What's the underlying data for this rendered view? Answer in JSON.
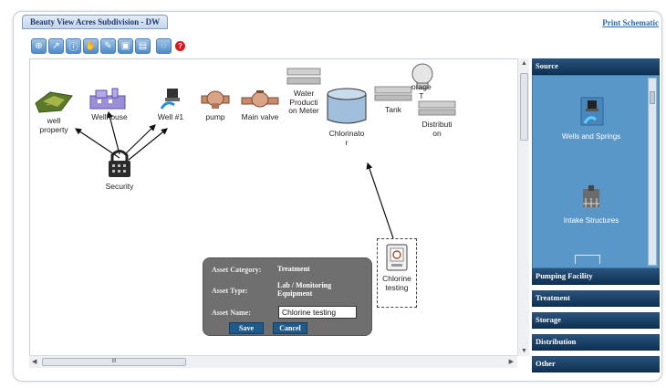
{
  "window": {
    "title": "Beauty View Acres Subdivision - DW",
    "print_link": "Print Schematic"
  },
  "toolbar": {
    "buttons": [
      {
        "name": "zoom-in-icon",
        "glyph": "⊕"
      },
      {
        "name": "arrow-icon",
        "glyph": "↗"
      },
      {
        "name": "info-icon",
        "glyph": "ⓘ"
      },
      {
        "name": "hand-icon",
        "glyph": "✋"
      },
      {
        "name": "pencil-icon",
        "glyph": "✎"
      },
      {
        "name": "layer-icon",
        "glyph": "▣"
      },
      {
        "name": "lock-icon",
        "glyph": "▤"
      },
      {
        "name": "zoom-out-icon",
        "glyph": "◌"
      }
    ],
    "help_glyph": "?"
  },
  "nodes": {
    "well_property": "well\nproperty",
    "wellhouse": "Wellhouse",
    "well1": "Well #1",
    "pump": "pump",
    "main_valve": "Main valve",
    "water_meter": "Water\nProducti\non Meter",
    "chlorinator": "Chlorinato\nr",
    "tank": "Tank",
    "storage_tank": "orage\nT",
    "distribution": "Distributi\non",
    "security": "Security",
    "chlorine_testing": "Chlorine\ntesting"
  },
  "dialog": {
    "category_label": "Asset Category:",
    "category_value": "Treatment",
    "type_label": "Asset Type:",
    "type_value": "Lab / Monitoring Equipment",
    "name_label": "Asset Name:",
    "name_value": "Chlorine testing",
    "save": "Save",
    "cancel": "Cancel"
  },
  "hscroll_grip": "III",
  "sidebar": {
    "sections": [
      {
        "label": "Source",
        "expanded": true
      },
      {
        "label": "Pumping Facility"
      },
      {
        "label": "Treatment"
      },
      {
        "label": "Storage"
      },
      {
        "label": "Distribution"
      },
      {
        "label": "Other"
      }
    ],
    "items": [
      {
        "label": "Wells and Springs"
      },
      {
        "label": "Intake Structures"
      }
    ]
  },
  "colors": {
    "accent": "#1f5a8c",
    "sidebar_header": "#0f3255",
    "palette_bg": "#5a97c9",
    "dialog_bg": "#6f6f6f",
    "help_red": "#d7161e"
  }
}
